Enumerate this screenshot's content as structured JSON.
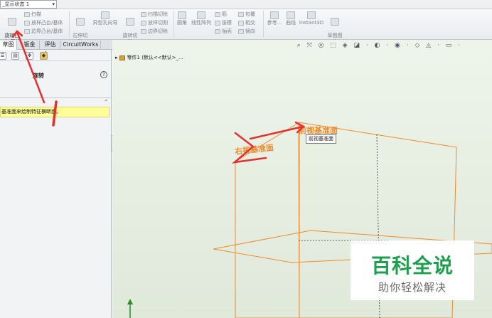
{
  "config": {
    "selector_value": "_显示状态 1"
  },
  "ribbon": {
    "revolve_boss": "旋转凸\n台/基体",
    "sweep": "扫描",
    "loft_boss": "放样凸台/基体",
    "boundary_boss": "边界凸台/基体",
    "extrude_cut": "拉伸切\n除",
    "hole_wizard": "异型孔向导",
    "revolve_cut": "旋转切\n除",
    "swept_cut": "扫描切除",
    "lofted_cut": "放样切割",
    "boundary_cut": "边界切除",
    "fillet": "圆角",
    "linear_pattern": "线性阵列",
    "rib": "筋",
    "draft": "拔模",
    "shell": "抽壳",
    "wrap": "包覆",
    "intersect": "相交",
    "mirror": "镜向",
    "reference": "参考...",
    "curves": "曲线",
    "instant3d": "Instant3D",
    "sketch_picture": "草图图\n片"
  },
  "tabs": [
    {
      "label": "草图",
      "active": true
    },
    {
      "label": "钣金",
      "active": false
    },
    {
      "label": "评估",
      "active": false
    },
    {
      "label": "CircuitWorks",
      "active": false
    }
  ],
  "panel": {
    "feature_title": "旋转",
    "help": "?",
    "message": "基准面来绘制特征横断面。"
  },
  "viewport": {
    "tree_root": "零件1 (默认<<默认>_...",
    "view_toolbar": "⌕ ⤧ ◎ ⬚ ◈ ◪ · ◐ · ◉ · ◇ ◬ · ▭ ·",
    "front_plane_label": "前视基准面",
    "right_plane_label": "右视基准面",
    "tooltip": "前视基准面"
  },
  "watermark": {
    "title": "百科全说",
    "subtitle": "助你轻松解决"
  },
  "colors": {
    "plane_orange": "#f08a2a",
    "annotation_red": "#e53030",
    "viewport_bg": "#e6efe1",
    "message_bg": "#ffff99",
    "watermark_green": "#1ca04d"
  }
}
